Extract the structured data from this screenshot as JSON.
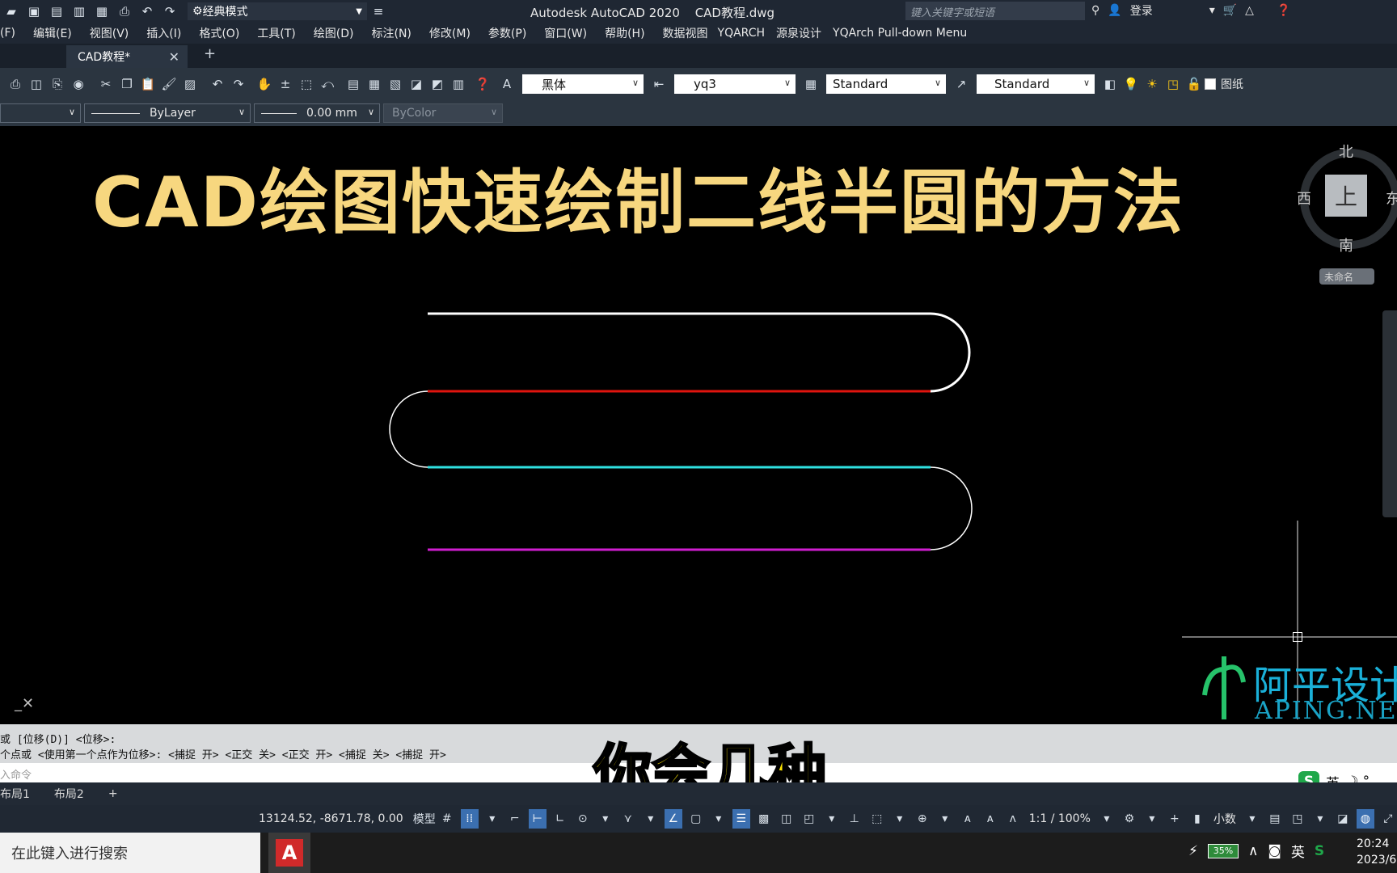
{
  "titlebar": {
    "workspace": "经典模式",
    "app_name": "Autodesk AutoCAD 2020",
    "file_name": "CAD教程.dwg",
    "search_placeholder": "键入关键字或短语",
    "login": "登录"
  },
  "menu": [
    "(F)",
    "编辑(E)",
    "视图(V)",
    "插入(I)",
    "格式(O)",
    "工具(T)",
    "绘图(D)",
    "标注(N)",
    "修改(M)",
    "参数(P)",
    "窗口(W)",
    "帮助(H)",
    "数据视图",
    "YQARCH",
    "源泉设计",
    "YQArch Pull-down Menu"
  ],
  "tabs": {
    "active": "CAD教程*",
    "add": "+"
  },
  "toolbar": {
    "font": "黑体",
    "dim_style": "yq3",
    "table_style": "Standard",
    "multileader_style": "Standard",
    "layer_name": "图纸"
  },
  "properties": {
    "linetype": "ByLayer",
    "lineweight": "0.00 mm",
    "plot_style": "ByColor"
  },
  "canvas": {
    "headline": "CAD绘图快速绘制二线半圆的方法",
    "viewcube_face": "上",
    "north": "北",
    "south": "南",
    "west": "西",
    "east": "东",
    "wcs": "未命名",
    "watermark_cn": "阿平设计",
    "watermark_en": "APING.NET"
  },
  "colors": {
    "line1": "#ffffff",
    "line2": "#e0140e",
    "line3": "#2fe0e0",
    "line4": "#d01ed0",
    "arc": "#ffffff",
    "headline": "#f7d77f"
  },
  "command": {
    "history1": "或 [位移(D)] <位移>:",
    "history2": "个点或 <使用第一个点作为位移>: <捕捉 开> <正交 关> <正交 开> <捕捉 关> <捕捉 开>",
    "prompt": "入命令"
  },
  "subtitle": "你会几种",
  "ime": {
    "lang": "英",
    "extra": "☽ °,"
  },
  "layouts": [
    "布局1",
    "布局2",
    "+"
  ],
  "status": {
    "coords": "13124.52, -8671.78, 0.00",
    "model": "模型",
    "scale": "1:1 / 100%",
    "units": "小数"
  },
  "taskbar": {
    "search": "在此键入进行搜索",
    "battery": "35%",
    "ime": "英",
    "time": "20:24",
    "date": "2023/6"
  }
}
